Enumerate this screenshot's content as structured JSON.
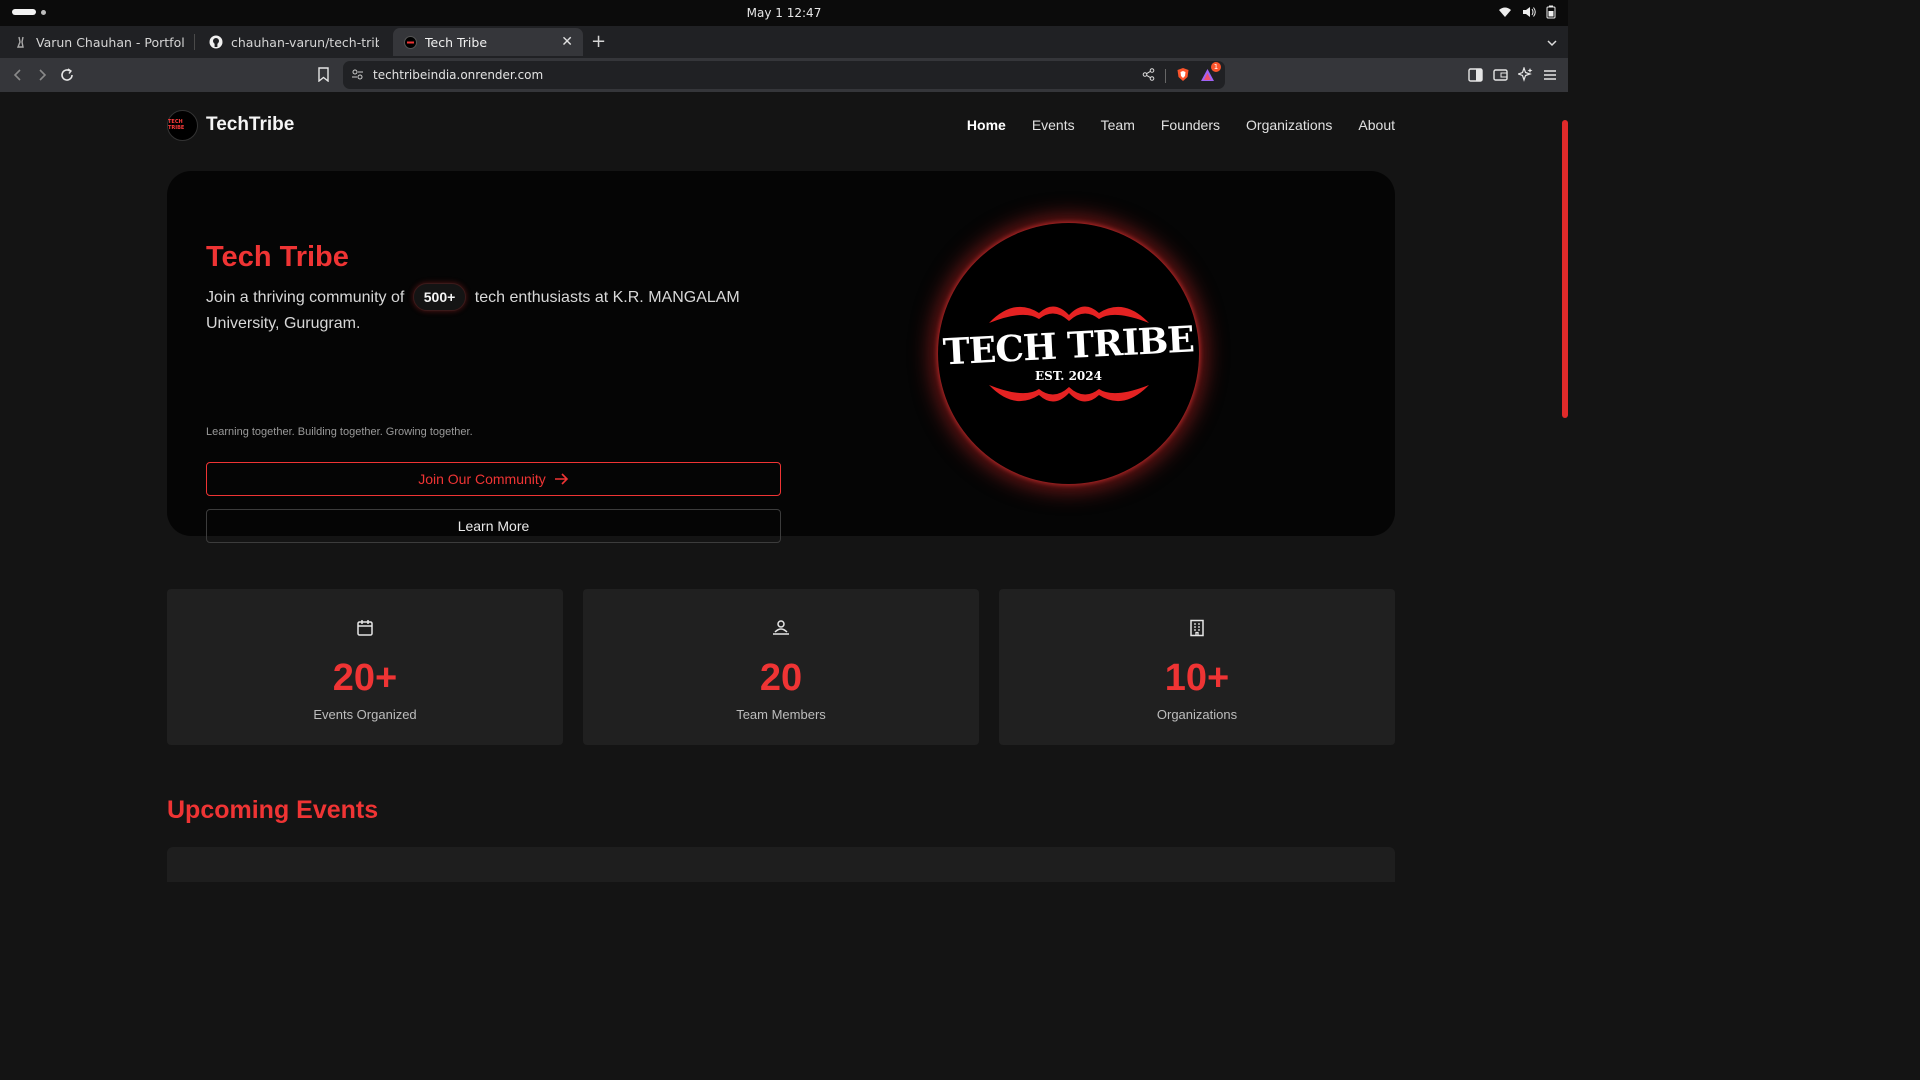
{
  "os": {
    "datetime": "May 1  12:47"
  },
  "browser": {
    "tabs": [
      {
        "title": "Varun Chauhan - Portfolio",
        "icon": "bunny-icon"
      },
      {
        "title": "chauhan-varun/tech-tribe: A",
        "icon": "github-icon"
      },
      {
        "title": "Tech Tribe",
        "icon": "techtribe-favicon",
        "active": true
      }
    ],
    "url": "techtribeindia.onrender.com",
    "brave_badge": "1"
  },
  "site": {
    "brand": "TechTribe",
    "logo_text": "TECH TRIBE",
    "nav": [
      "Home",
      "Events",
      "Team",
      "Founders",
      "Organizations",
      "About"
    ],
    "hero": {
      "title": "Tech Tribe",
      "text_before": "Join a thriving community of",
      "chip": "500+",
      "text_after": "tech enthusiasts at K.R. MANGALAM University, Gurugram.",
      "tagline": "Learning together. Building together. Growing together.",
      "join_button": "Join Our Community",
      "learn_button": "Learn More",
      "logo_main": "TECH TRIBE",
      "logo_est": "EST. 2024"
    },
    "stats": [
      {
        "value": "20+",
        "label": "Events Organized",
        "icon": "calendar-icon"
      },
      {
        "value": "20",
        "label": "Team Members",
        "icon": "users-icon"
      },
      {
        "value": "10+",
        "label": "Organizations",
        "icon": "building-icon"
      }
    ],
    "upcoming_title": "Upcoming Events"
  },
  "colors": {
    "accent": "#ef3434",
    "background": "#141414",
    "card": "#202020"
  }
}
